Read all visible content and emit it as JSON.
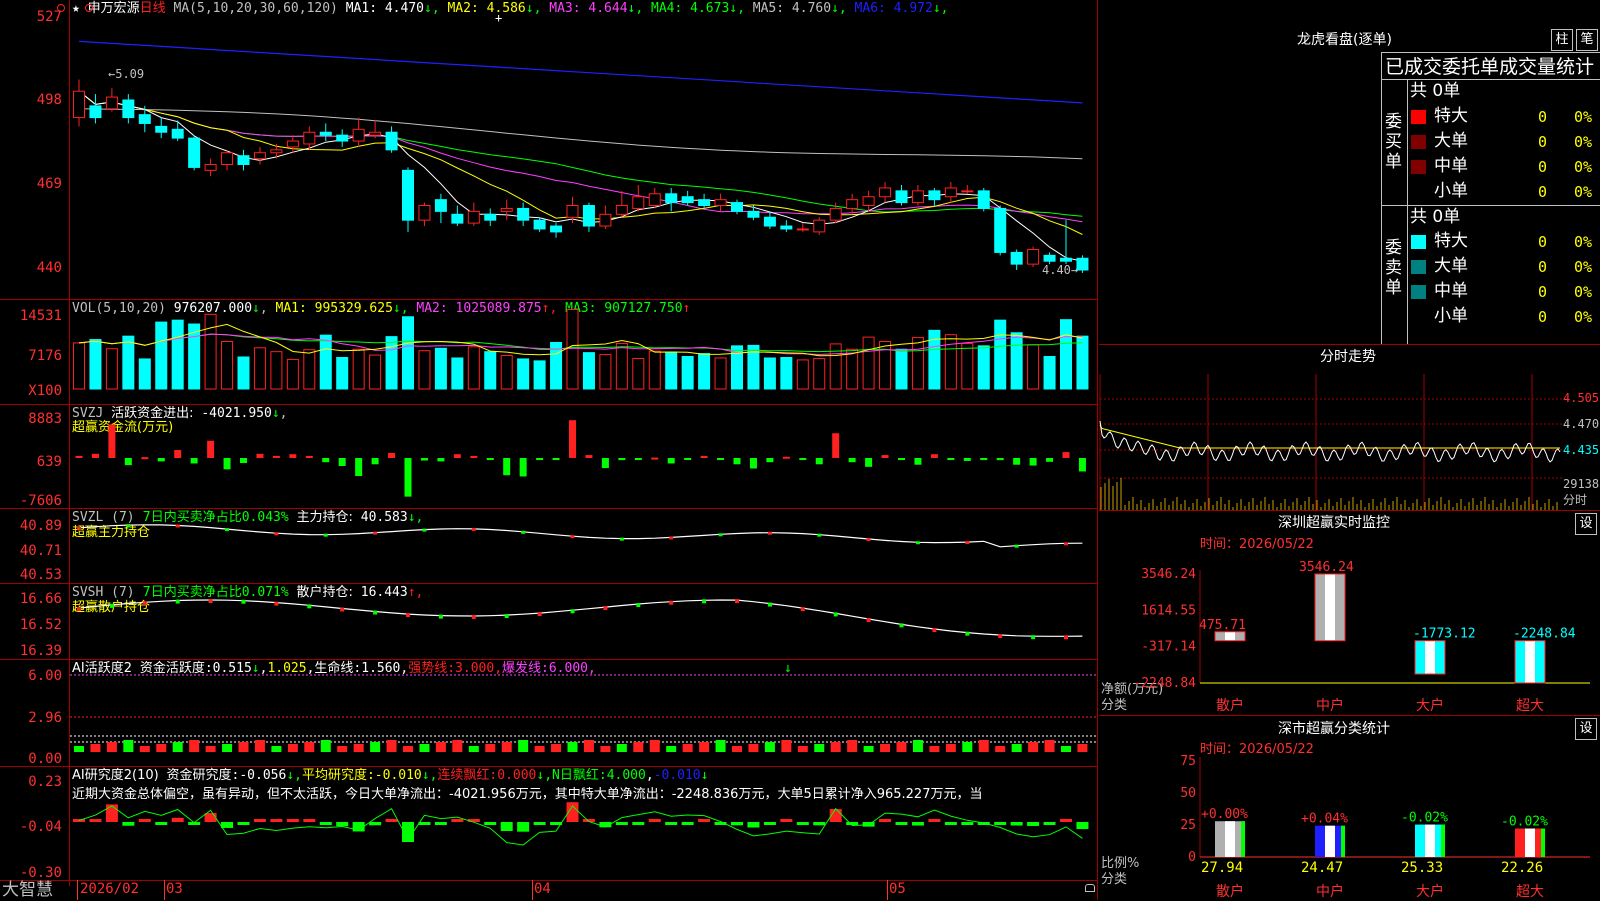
{
  "colors": {
    "up": "#ff2020",
    "down": "#00ffff",
    "green": "#00ff00",
    "yellow": "#ffff00",
    "magenta": "#ff40ff",
    "blue": "#2020ff",
    "white": "#ffffff",
    "frame": "#a00000"
  },
  "main": {
    "star": "★",
    "stock_name": "申万宏源",
    "period": "日线",
    "ma_params": "MA(5,10,20,30,60,120)",
    "ma": [
      {
        "label": "MA1:",
        "value": "4.470",
        "arrow": "↓",
        "color": "#ffffff"
      },
      {
        "label": "MA2:",
        "value": "4.586",
        "arrow": "↓",
        "color": "#ffff00"
      },
      {
        "label": "MA3:",
        "value": "4.644",
        "arrow": "↓",
        "color": "#ff40ff"
      },
      {
        "label": "MA4:",
        "value": "4.673",
        "arrow": "↓",
        "color": "#00ff00"
      },
      {
        "label": "MA5:",
        "value": "4.760",
        "arrow": "↓",
        "color": "#c0c0c0"
      },
      {
        "label": "MA6:",
        "value": "4.972",
        "arrow": "↓",
        "color": "#2020ff"
      }
    ],
    "y_ticks": [
      "527",
      "498",
      "469",
      "440"
    ],
    "high_label": "5.09",
    "low_label": "4.40",
    "candles": [
      [
        4.92,
        5.01,
        5.05,
        4.89
      ],
      [
        4.96,
        4.92,
        5.0,
        4.9
      ],
      [
        4.95,
        4.99,
        5.02,
        4.94
      ],
      [
        4.98,
        4.92,
        5.0,
        4.9
      ],
      [
        4.93,
        4.9,
        4.96,
        4.87
      ],
      [
        4.89,
        4.87,
        4.92,
        4.85
      ],
      [
        4.88,
        4.85,
        4.91,
        4.84
      ],
      [
        4.85,
        4.75,
        4.86,
        4.74
      ],
      [
        4.74,
        4.76,
        4.78,
        4.72
      ],
      [
        4.76,
        4.8,
        4.81,
        4.74
      ],
      [
        4.79,
        4.76,
        4.81,
        4.74
      ],
      [
        4.78,
        4.8,
        4.82,
        4.76
      ],
      [
        4.8,
        4.81,
        4.83,
        4.78
      ],
      [
        4.82,
        4.84,
        4.86,
        4.8
      ],
      [
        4.83,
        4.87,
        4.89,
        4.81
      ],
      [
        4.87,
        4.86,
        4.9,
        4.84
      ],
      [
        4.86,
        4.84,
        4.88,
        4.82
      ],
      [
        4.84,
        4.88,
        4.92,
        4.82
      ],
      [
        4.86,
        4.87,
        4.91,
        4.85
      ],
      [
        4.87,
        4.81,
        4.89,
        4.8
      ],
      [
        4.74,
        4.57,
        4.75,
        4.53
      ],
      [
        4.57,
        4.62,
        4.63,
        4.55
      ],
      [
        4.64,
        4.6,
        4.66,
        4.56
      ],
      [
        4.59,
        4.56,
        4.62,
        4.55
      ],
      [
        4.56,
        4.6,
        4.63,
        4.55
      ],
      [
        4.59,
        4.57,
        4.61,
        4.55
      ],
      [
        4.6,
        4.61,
        4.64,
        4.57
      ],
      [
        4.61,
        4.57,
        4.63,
        4.55
      ],
      [
        4.57,
        4.54,
        4.58,
        4.53
      ],
      [
        4.55,
        4.53,
        4.56,
        4.51
      ],
      [
        4.58,
        4.62,
        4.65,
        4.56
      ],
      [
        4.62,
        4.55,
        4.63,
        4.53
      ],
      [
        4.55,
        4.59,
        4.62,
        4.54
      ],
      [
        4.59,
        4.62,
        4.67,
        4.58
      ],
      [
        4.61,
        4.65,
        4.69,
        4.6
      ],
      [
        4.62,
        4.66,
        4.68,
        4.61
      ],
      [
        4.66,
        4.63,
        4.68,
        4.6
      ],
      [
        4.65,
        4.63,
        4.67,
        4.62
      ],
      [
        4.64,
        4.62,
        4.66,
        4.61
      ],
      [
        4.62,
        4.64,
        4.66,
        4.6
      ],
      [
        4.63,
        4.6,
        4.64,
        4.59
      ],
      [
        4.6,
        4.58,
        4.62,
        4.57
      ],
      [
        4.58,
        4.55,
        4.6,
        4.54
      ],
      [
        4.55,
        4.54,
        4.57,
        4.53
      ],
      [
        4.54,
        4.54,
        4.56,
        4.53
      ],
      [
        4.53,
        4.57,
        4.58,
        4.52
      ],
      [
        4.57,
        4.61,
        4.63,
        4.56
      ],
      [
        4.61,
        4.64,
        4.66,
        4.59
      ],
      [
        4.62,
        4.65,
        4.67,
        4.6
      ],
      [
        4.65,
        4.68,
        4.7,
        4.63
      ],
      [
        4.67,
        4.63,
        4.69,
        4.62
      ],
      [
        4.63,
        4.67,
        4.69,
        4.62
      ],
      [
        4.67,
        4.64,
        4.68,
        4.62
      ],
      [
        4.65,
        4.68,
        4.7,
        4.63
      ],
      [
        4.67,
        4.67,
        4.69,
        4.66
      ],
      [
        4.67,
        4.61,
        4.68,
        4.6
      ],
      [
        4.61,
        4.46,
        4.62,
        4.45
      ],
      [
        4.46,
        4.42,
        4.47,
        4.4
      ],
      [
        4.42,
        4.47,
        4.48,
        4.41
      ],
      [
        4.45,
        4.43,
        4.46,
        4.42
      ],
      [
        4.44,
        4.43,
        4.57,
        4.42
      ],
      [
        4.44,
        4.4,
        4.45,
        4.39
      ]
    ]
  },
  "vol": {
    "params": "VOL(5,10,20)",
    "value": "976207.000",
    "ma": [
      {
        "label": "MA1:",
        "value": "995329.625",
        "arrow": "↓",
        "color": "#ffff00"
      },
      {
        "label": "MA2:",
        "value": "1025089.875",
        "arrow": "↑",
        "color": "#ff40ff"
      },
      {
        "label": "MA3:",
        "value": "907127.750",
        "arrow": "↑",
        "color": "#00ff00"
      }
    ],
    "y_ticks": [
      "14531",
      "7176",
      "X100"
    ],
    "values": [
      9.5,
      10.2,
      8.3,
      10.9,
      6.2,
      13.8,
      14.2,
      13.4,
      15.4,
      9.8,
      6.6,
      8.5,
      7.7,
      6.1,
      8.1,
      11.1,
      6.5,
      8.2,
      7.0,
      10.8,
      14.9,
      7.9,
      8.4,
      6.4,
      8.7,
      7.7,
      6.9,
      6.2,
      5.8,
      9.6,
      16.4,
      7.5,
      7.1,
      9.4,
      6.3,
      7.8,
      7.6,
      6.7,
      7.3,
      6.4,
      8.9,
      9.0,
      6.4,
      6.5,
      6.0,
      6.3,
      9.3,
      8.2,
      10.7,
      9.8,
      8.2,
      10.6,
      12.1,
      11.2,
      9.4,
      8.9,
      14.2,
      11.6,
      9.1,
      6.7,
      14.3,
      10.9
    ]
  },
  "svzj": {
    "name": "SVZJ",
    "label": "活跃资金进出:",
    "value": "-4021.950",
    "arrow": "↓",
    "subtitle": "超赢资金流(万元)",
    "y_ticks": [
      "8883",
      "639",
      "-7606"
    ],
    "values": [
      0.5,
      1.0,
      8.0,
      -1.7,
      0.2,
      -0.8,
      1.9,
      -1.3,
      4.1,
      -2.7,
      -1.2,
      1.0,
      0.5,
      0.9,
      0.5,
      -1.0,
      -1.9,
      -4.3,
      -1.5,
      1.2,
      -9.2,
      -0.6,
      -0.8,
      0.9,
      0.5,
      -0.3,
      -4.1,
      -4.4,
      -0.2,
      -0.3,
      9.0,
      0.7,
      -2.4,
      -0.5,
      -0.4,
      0.1,
      -1.3,
      -0.3,
      0.5,
      -0.2,
      -1.5,
      -2.5,
      -1.0,
      0.3,
      -0.4,
      -1.5,
      5.9,
      -1.0,
      -2.1,
      0.7,
      -0.4,
      -1.6,
      0.9,
      -0.4,
      -0.7,
      -0.3,
      -0.5,
      -1.6,
      -1.8,
      -0.9,
      1.4,
      -3.2
    ]
  },
  "svzl": {
    "name": "SVZL",
    "param": "(7)",
    "label1": "7日内买卖净占比",
    "value1": "0.043%",
    "label2": "主力持仓:",
    "value2": "40.583",
    "arrow": "↓,",
    "subtitle": "超赢主力持仓",
    "y_ticks": [
      "40.89",
      "40.71",
      "40.53"
    ]
  },
  "svsh": {
    "name": "SVSH",
    "param": "(7)",
    "label1": "7日内买卖净占比",
    "value1": "0.071%",
    "label2": "散户持仓:",
    "value2": "16.443",
    "arrow": "↑,",
    "subtitle": "超赢散户持仓",
    "y_ticks": [
      "16.66",
      "16.52",
      "16.39"
    ]
  },
  "ai1": {
    "name": "AI活跃度2",
    "items": [
      {
        "text": "资金活跃度:",
        "color": "#ffffff"
      },
      {
        "text": "0.515",
        "color": "#ffffff"
      },
      {
        "text": "↓",
        "color": "#00ff00"
      },
      {
        "text": ",",
        "color": "#ffffff"
      },
      {
        "text": "1.025",
        "color": "#ffff00"
      },
      {
        "text": ",",
        "color": "#ffffff"
      },
      {
        "text": "生命线:",
        "color": "#ffffff"
      },
      {
        "text": "1.560",
        "color": "#ffffff"
      },
      {
        "text": ",",
        "color": "#ffffff"
      },
      {
        "text": "强势线:",
        "color": "#ff2020"
      },
      {
        "text": "3.000",
        "color": "#ff2020"
      },
      {
        "text": ",",
        "color": "#ff2020"
      },
      {
        "text": "爆发线:",
        "color": "#ff40ff"
      },
      {
        "text": "6.000",
        "color": "#ff40ff"
      },
      {
        "text": ",",
        "color": "#ff40ff"
      }
    ],
    "y_ticks": [
      "6.00",
      "2.96",
      "0.00"
    ]
  },
  "ai2": {
    "name": "AI研究度2(10)",
    "items": [
      {
        "text": "资金研究度:",
        "color": "#ffffff"
      },
      {
        "text": "-0.056",
        "color": "#ffffff"
      },
      {
        "text": "↓,",
        "color": "#00ff00"
      },
      {
        "text": "平均研究度:",
        "color": "#ffff00"
      },
      {
        "text": "-0.010",
        "color": "#ffff00"
      },
      {
        "text": "↓,",
        "color": "#00ff00"
      },
      {
        "text": "连续飘红:",
        "color": "#ff2020"
      },
      {
        "text": "0.000",
        "color": "#ff2020"
      },
      {
        "text": "↓,",
        "color": "#00ff00"
      },
      {
        "text": "N日飘红:",
        "color": "#00ff00"
      },
      {
        "text": "4.000",
        "color": "#00ff00"
      },
      {
        "text": ",",
        "color": "#ffffff"
      },
      {
        "text": "-0.010",
        "color": "#2020ff"
      },
      {
        "text": "↓",
        "color": "#00ff00"
      }
    ],
    "desc": "近期大资金总体偏空，虽有异动，但不太活跃，今日大单净流出：-4021.956万元，其中特大单净流出：-2248.836万元，大单5日累计净入965.227万元，当",
    "y_ticks": [
      "0.23",
      "-0.04",
      "-0.30"
    ]
  },
  "bottom": {
    "brand": "大智慧",
    "dates": [
      "2026/02",
      "03",
      "04",
      "05"
    ]
  },
  "right": {
    "dragon": {
      "title": "龙虎看盘(逐单)",
      "btn1": "柱",
      "btn2": "笔",
      "subtitle": "已成交委托单成交量统计"
    },
    "buy": {
      "group": "委买单",
      "total": "共 0单",
      "rows": [
        {
          "name": "特大",
          "count": "0",
          "pct": "0%",
          "color": "#ff0000"
        },
        {
          "name": "大单",
          "count": "0",
          "pct": "0%",
          "color": "#800000"
        },
        {
          "name": "中单",
          "count": "0",
          "pct": "0%",
          "color": "#800000"
        },
        {
          "name": "小单",
          "count": "0",
          "pct": "0%",
          "color": "#000000"
        }
      ]
    },
    "sell": {
      "group": "委卖单",
      "total": "共 0单",
      "rows": [
        {
          "name": "特大",
          "count": "0",
          "pct": "0%",
          "color": "#00ffff"
        },
        {
          "name": "大单",
          "count": "0",
          "pct": "0%",
          "color": "#008080"
        },
        {
          "name": "中单",
          "count": "0",
          "pct": "0%",
          "color": "#008080"
        },
        {
          "name": "小单",
          "count": "0",
          "pct": "0%",
          "color": "#000000"
        }
      ]
    },
    "intraday": {
      "title": "分时走势",
      "y_ticks": [
        "4.505",
        "4.470",
        "4.435"
      ],
      "vol_label": "29138",
      "vol_unit": "分时"
    },
    "monitor": {
      "title": "深圳超赢实时监控",
      "btn": "设",
      "time_label": "时间：",
      "time": "2026/05/22",
      "y_ticks": [
        "3546.24",
        "1614.55",
        "-317.14",
        "-2248.84"
      ],
      "categories": [
        "散户",
        "中户",
        "大户",
        "超大"
      ],
      "values": [
        475.71,
        3546.24,
        -1773.12,
        -2248.84
      ],
      "value_labels": [
        "475.71",
        "3546.24",
        "-1773.12",
        "-2248.84"
      ],
      "ylabel": "净额(万元)",
      "xlabel": "分类"
    },
    "classify": {
      "title": "深市超赢分类统计",
      "btn": "设",
      "time_label": "时间：",
      "time": "2026/05/22",
      "y_ticks": [
        "75",
        "50",
        "25",
        "0"
      ],
      "categories": [
        "散户",
        "中户",
        "大户",
        "超大"
      ],
      "values": [
        27.94,
        24.47,
        25.33,
        22.26
      ],
      "change_labels": [
        "+0.00%",
        "+0.04%",
        "-0.02%",
        "-0.02%"
      ],
      "ylabel": "比例%",
      "xlabel": "分类"
    }
  },
  "chart_data": [
    {
      "type": "bar",
      "title": "深圳超赢实时监控",
      "categories": [
        "散户",
        "中户",
        "大户",
        "超大"
      ],
      "values": [
        475.71,
        3546.24,
        -1773.12,
        -2248.84
      ],
      "ylabel": "净额(万元)",
      "xlabel": "分类",
      "ylim": [
        -2248.84,
        3546.24
      ]
    },
    {
      "type": "bar",
      "title": "深市超赢分类统计",
      "categories": [
        "散户",
        "中户",
        "大户",
        "超大"
      ],
      "values": [
        27.94,
        24.47,
        25.33,
        22.26
      ],
      "ylabel": "比例%",
      "xlabel": "分类",
      "ylim": [
        0,
        75
      ]
    }
  ]
}
